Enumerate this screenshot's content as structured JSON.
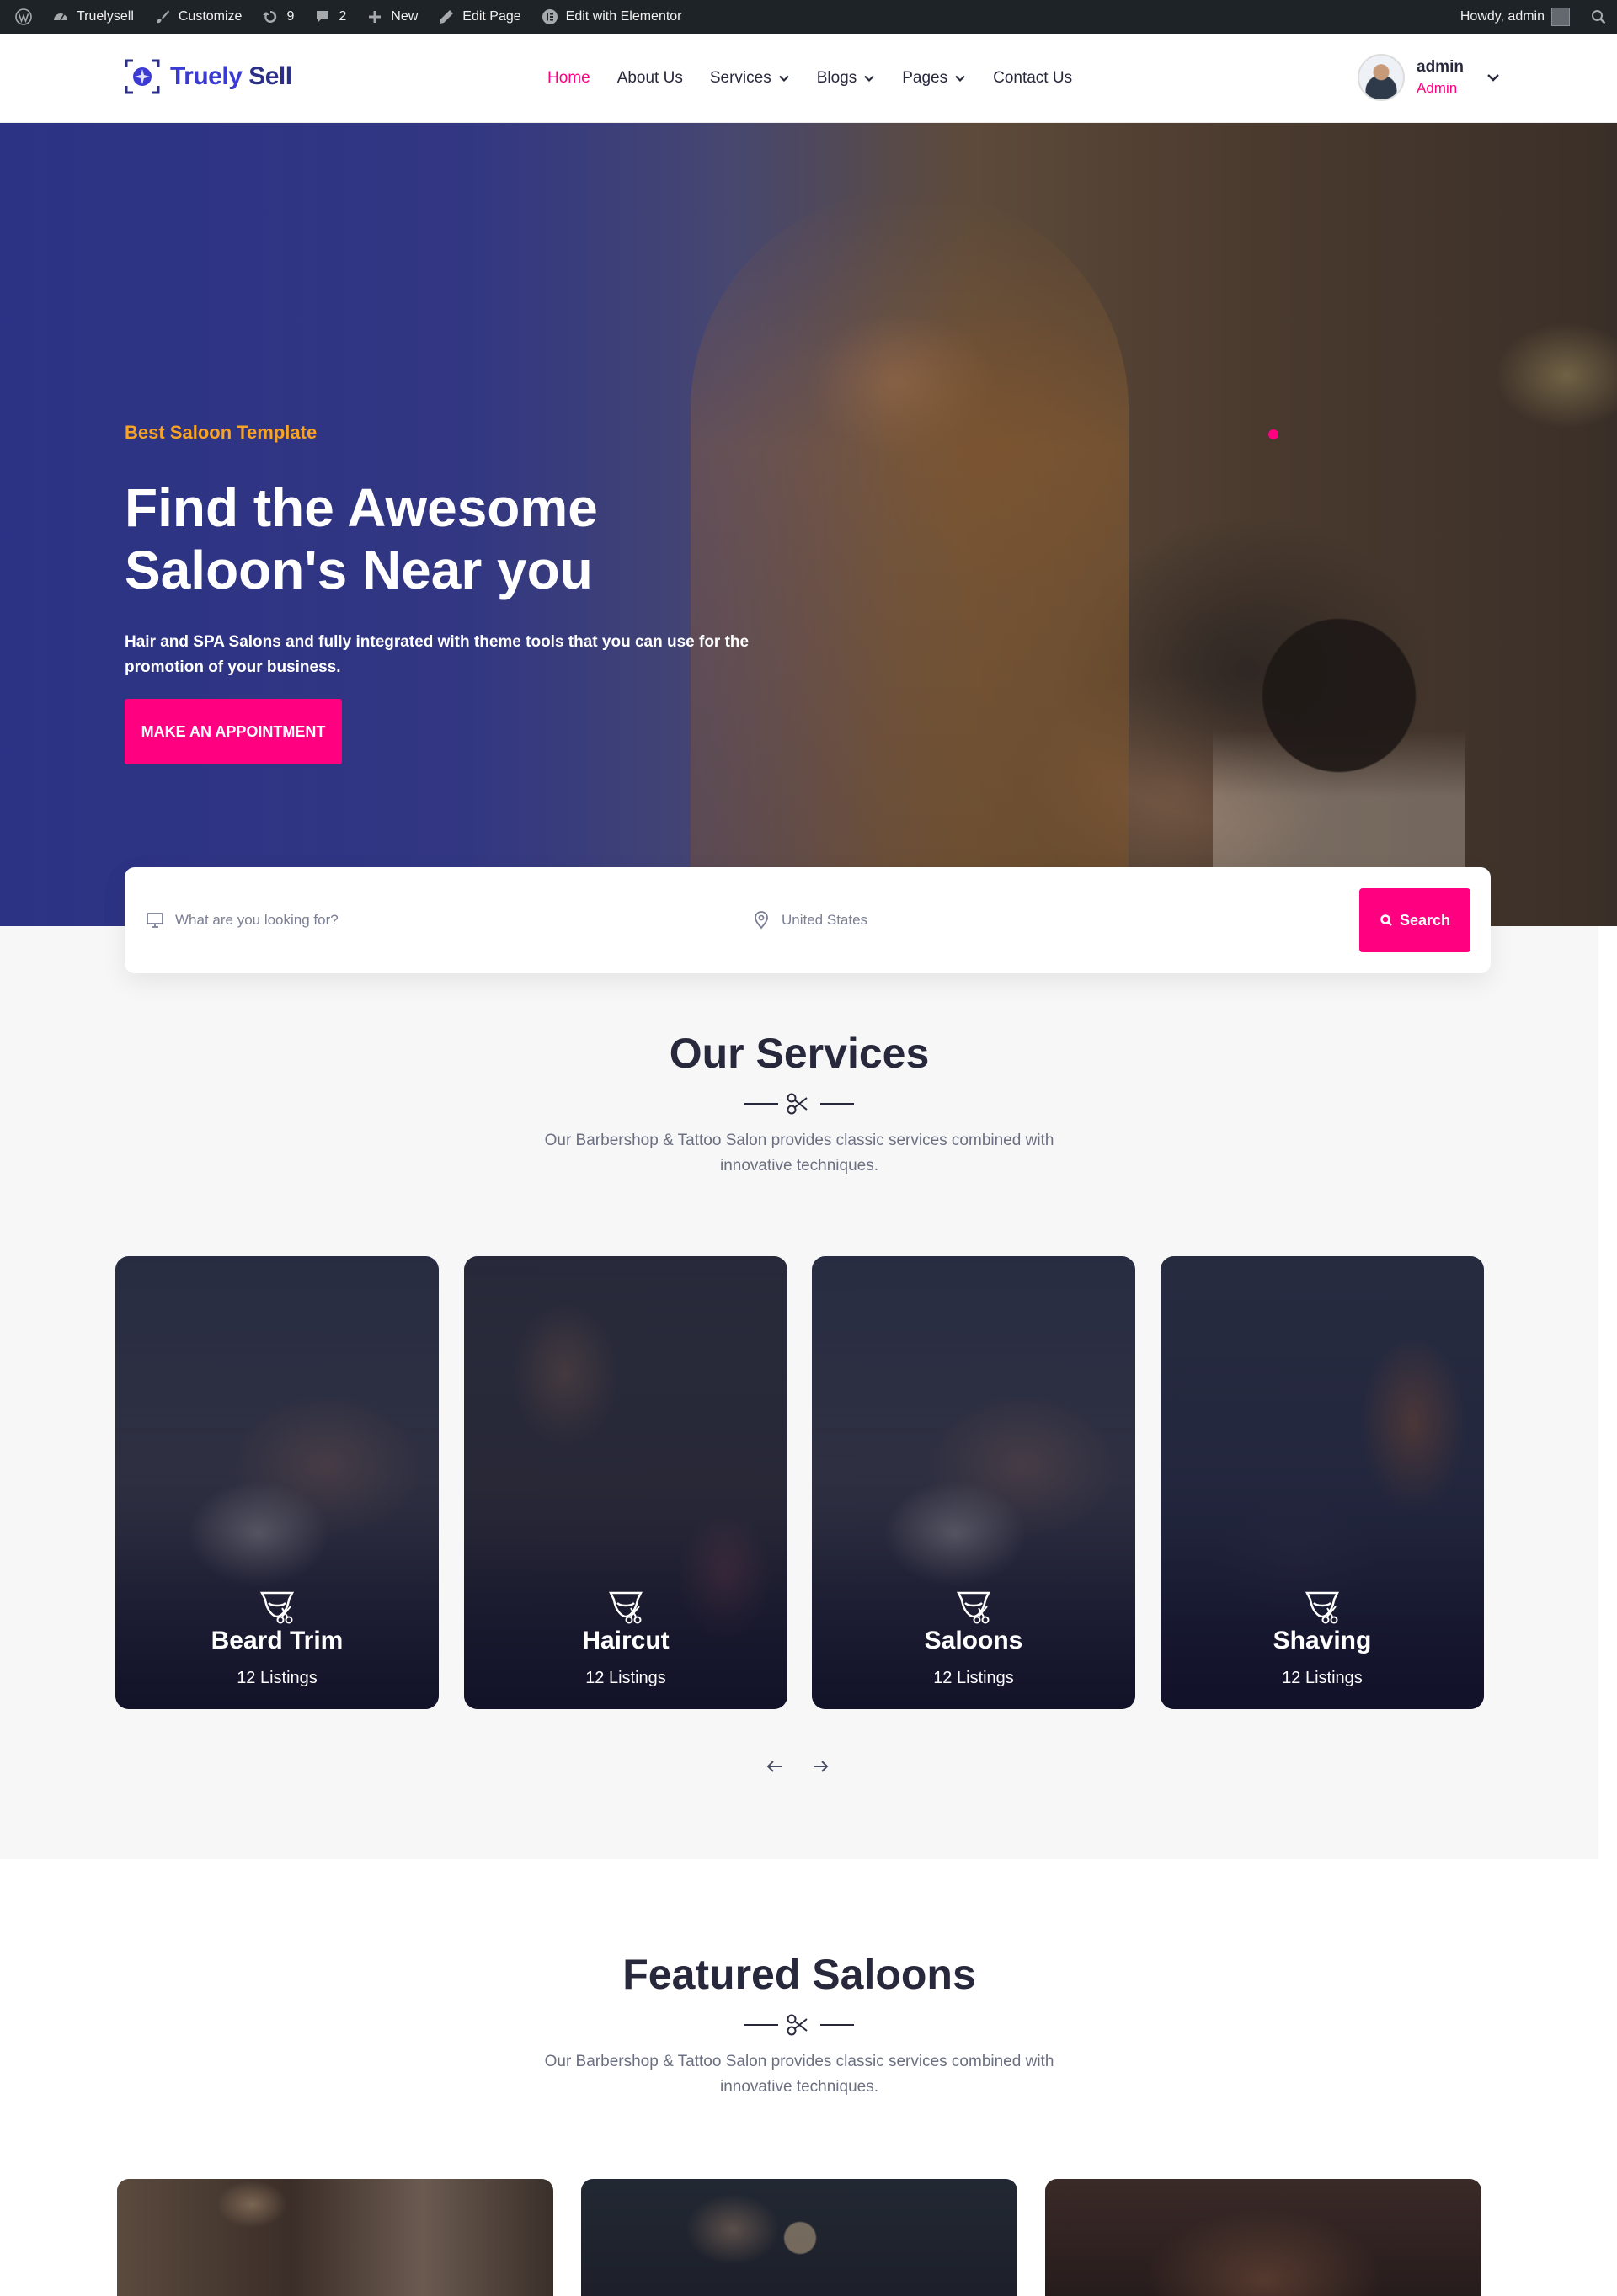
{
  "admin_bar": {
    "site_name": "Truelysell",
    "customize": "Customize",
    "updates_count": "9",
    "comments_count": "2",
    "new_label": "New",
    "edit_page": "Edit Page",
    "edit_elementor": "Edit with Elementor",
    "howdy": "Howdy, admin"
  },
  "header": {
    "logo_part1": "Truely",
    "logo_part2": "Sell",
    "nav": [
      {
        "label": "Home",
        "active": true
      },
      {
        "label": "About Us"
      },
      {
        "label": "Services",
        "dropdown": true
      },
      {
        "label": "Blogs",
        "dropdown": true
      },
      {
        "label": "Pages",
        "dropdown": true
      },
      {
        "label": "Contact Us"
      }
    ],
    "user_name": "admin",
    "user_role": "Admin"
  },
  "hero": {
    "tag": "Best Saloon Template",
    "title": "Find the Awesome Saloon's Near you",
    "description": "Hair and SPA Salons and fully integrated with theme tools that you can use for the promotion of your business.",
    "button": "MAKE AN APPOINTMENT"
  },
  "search": {
    "what_placeholder": "What are you looking for?",
    "location": "United States",
    "button": "Search"
  },
  "services": {
    "title": "Our Services",
    "subtitle": "Our Barbershop & Tattoo Salon provides classic services combined with innovative techniques.",
    "cards": [
      {
        "title": "Beard Trim",
        "count": "12 Listings"
      },
      {
        "title": "Haircut",
        "count": "12 Listings"
      },
      {
        "title": "Saloons",
        "count": "12 Listings"
      },
      {
        "title": "Shaving",
        "count": "12 Listings"
      }
    ]
  },
  "featured": {
    "title": "Featured Saloons",
    "subtitle": "Our Barbershop & Tattoo Salon provides classic services combined with innovative techniques."
  },
  "colors": {
    "accent": "#ff0080",
    "tag": "#f7a325",
    "logo": "#3b3bd3",
    "admin_bar": "#1d2327",
    "heading": "#28283c"
  }
}
